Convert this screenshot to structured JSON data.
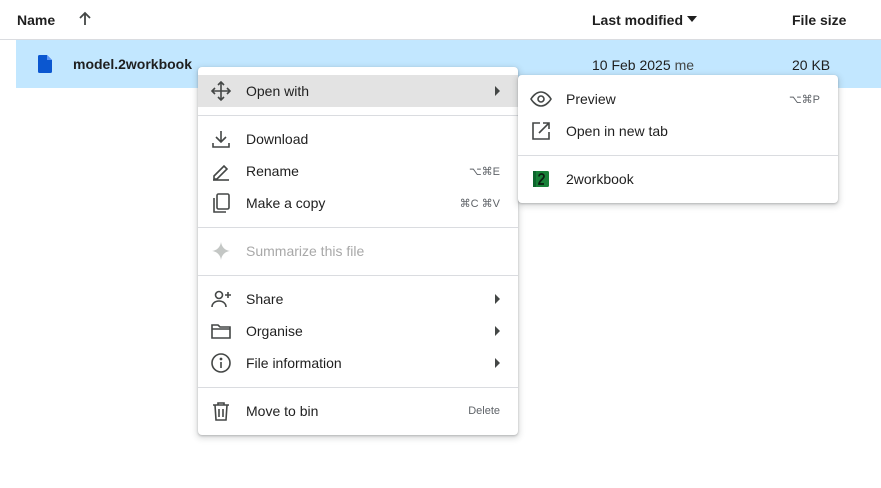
{
  "header": {
    "name_label": "Name",
    "modified_label": "Last modified",
    "size_label": "File size"
  },
  "file": {
    "name": "model.2workbook",
    "modified_date": "10 Feb 2025",
    "modified_by": "me",
    "size": "20 KB",
    "icon": "document-icon",
    "icon_color": "#0b57d0"
  },
  "context_menu": {
    "open_with": {
      "label": "Open with",
      "icon": "move-arrows-icon"
    },
    "download": {
      "label": "Download",
      "icon": "download-icon"
    },
    "rename": {
      "label": "Rename",
      "shortcut": "⌥⌘E",
      "icon": "pencil-icon"
    },
    "make_copy": {
      "label": "Make a copy",
      "shortcut": "⌘C ⌘V",
      "icon": "copy-icon"
    },
    "summarize": {
      "label": "Summarize this file",
      "icon": "sparkle-icon",
      "disabled": true
    },
    "share": {
      "label": "Share",
      "icon": "person-add-icon"
    },
    "organise": {
      "label": "Organise",
      "icon": "folder-icon"
    },
    "file_information": {
      "label": "File information",
      "icon": "info-icon"
    },
    "move_to_bin": {
      "label": "Move to bin",
      "shortcut": "Delete",
      "icon": "trash-icon"
    }
  },
  "submenu": {
    "preview": {
      "label": "Preview",
      "shortcut": "⌥⌘P",
      "icon": "eye-icon"
    },
    "open_new_tab": {
      "label": "Open in new tab",
      "icon": "open-new-tab-icon"
    },
    "app_2workbook": {
      "label": "2workbook",
      "icon": "2workbook-app-icon",
      "icon_color": "#188038"
    }
  },
  "colors": {
    "selection": "#c2e7ff",
    "hover": "#e3e3e3",
    "text": "#1f1f1f",
    "muted": "#5f6368"
  }
}
